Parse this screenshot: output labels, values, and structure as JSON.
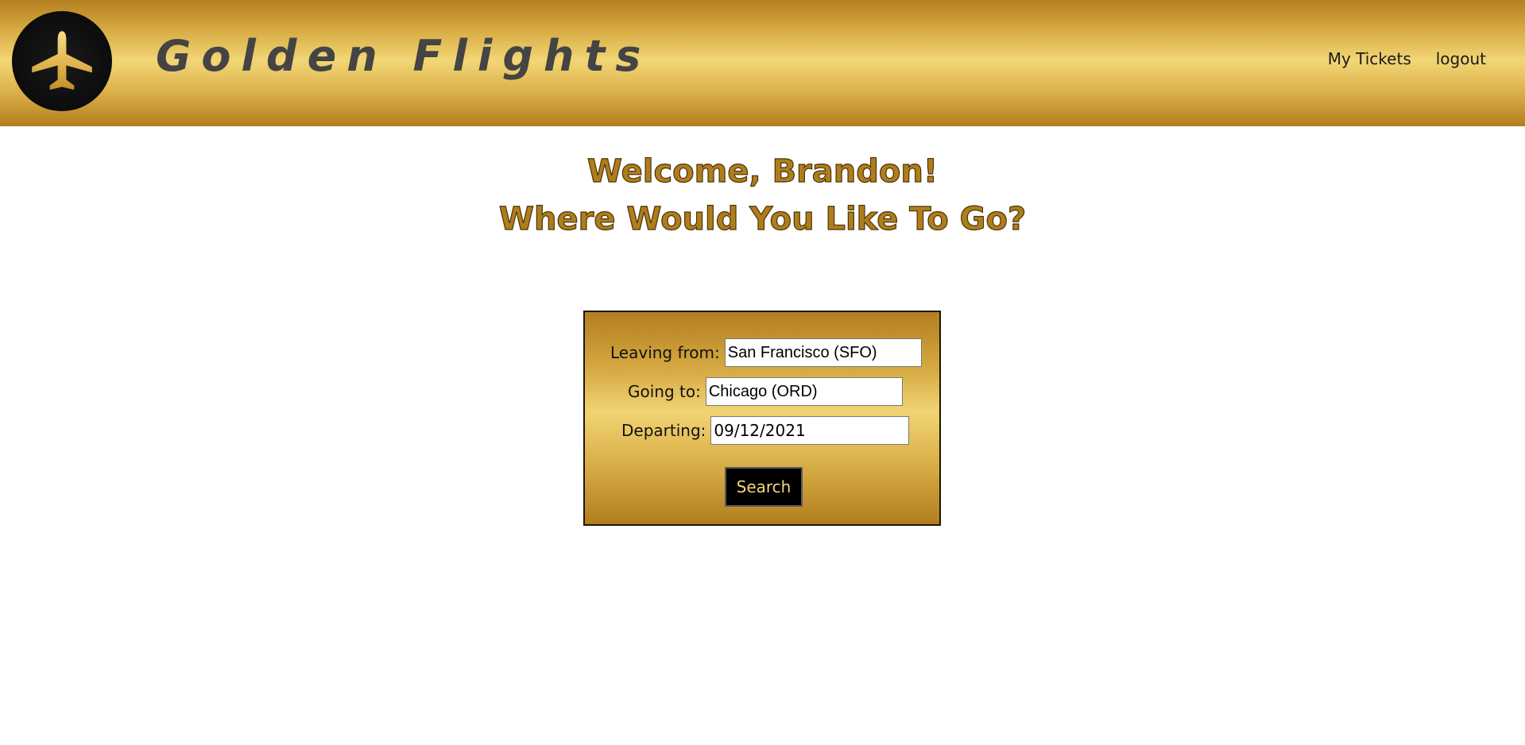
{
  "header": {
    "brand": "Golden Flights",
    "logo_icon": "airplane-icon",
    "nav": {
      "my_tickets": "My Tickets",
      "logout": "logout"
    }
  },
  "main": {
    "welcome_line1": "Welcome, Brandon!",
    "welcome_line2": "Where Would You Like To Go?"
  },
  "search_form": {
    "leaving_label": "Leaving from:",
    "leaving_value": "San Francisco (SFO)",
    "going_label": "Going to:",
    "going_value": "Chicago (ORD)",
    "departing_label": "Departing:",
    "departing_value": "09/12/2021",
    "search_label": "Search"
  },
  "colors": {
    "gold_light": "#f2d676",
    "gold_dark": "#b47f1e",
    "heading_gold": "#b07d1d",
    "button_text": "#f3d777"
  }
}
